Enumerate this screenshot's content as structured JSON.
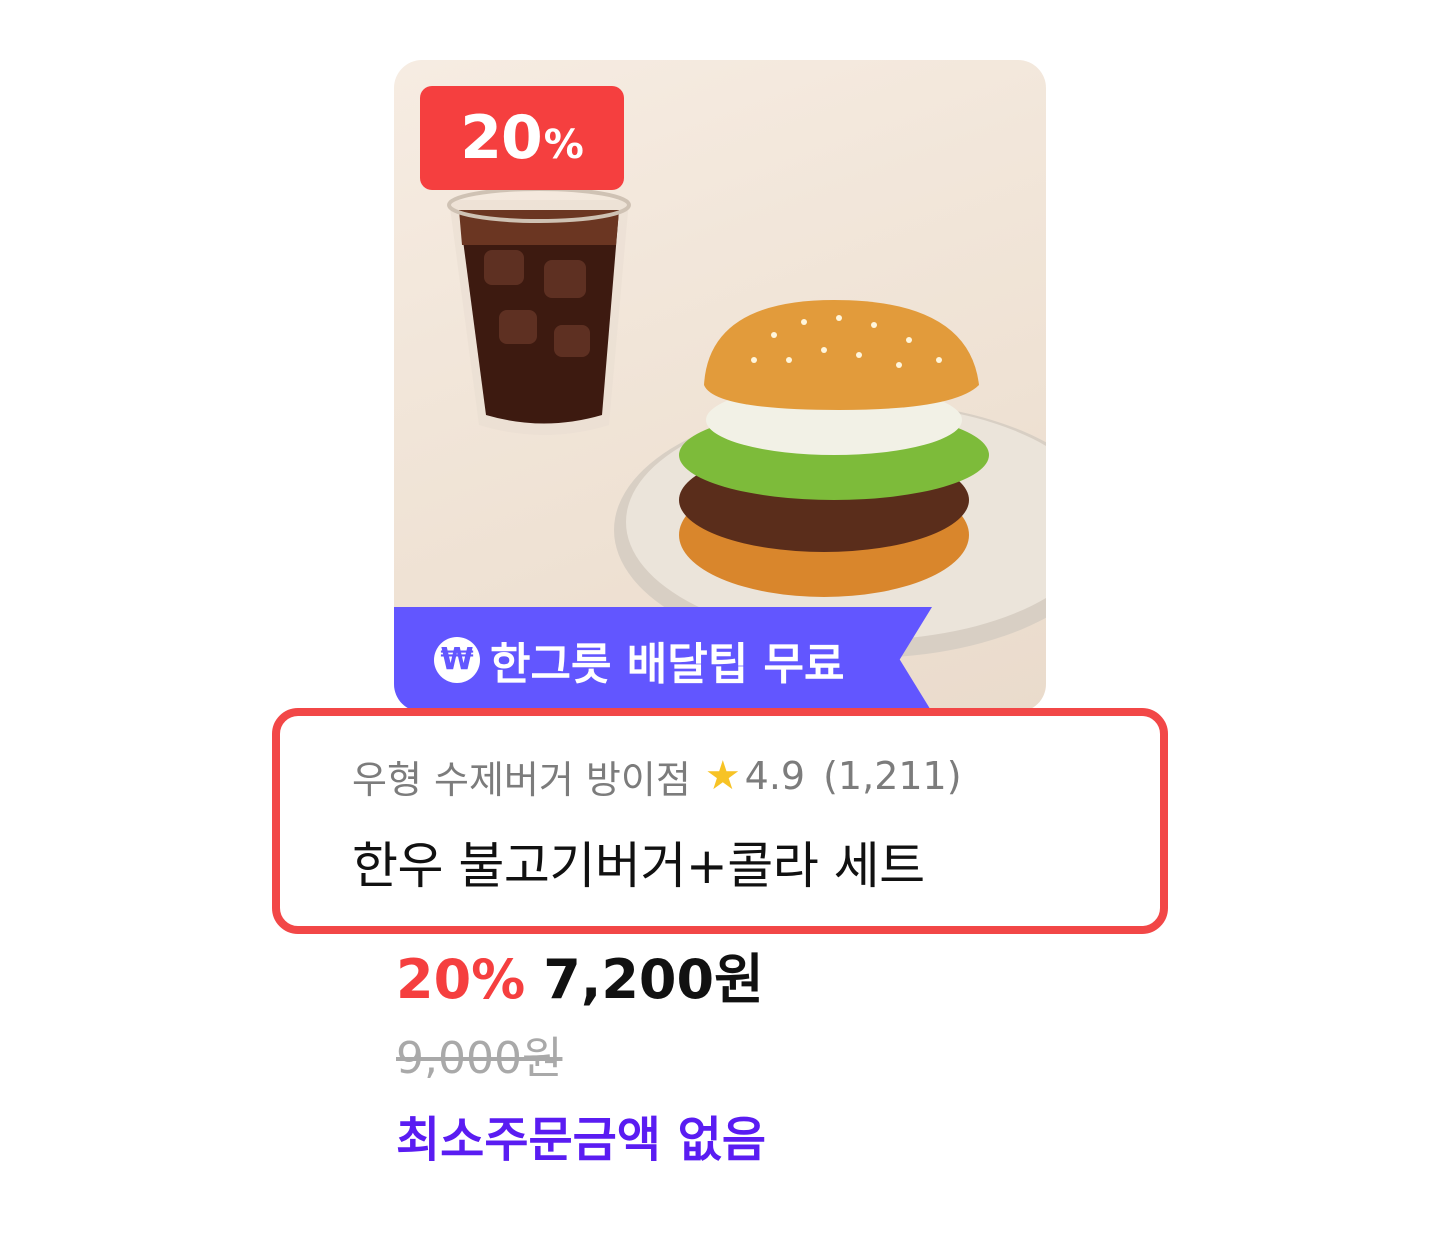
{
  "card": {
    "image_alt_icon": "burger-cola-photo",
    "discount_badge": {
      "value": "20",
      "suffix": "%"
    },
    "delivery_ribbon": {
      "icon": "won-coin-icon",
      "icon_glyph": "₩",
      "label": "한그릇 배달팁 무료"
    },
    "store": {
      "name": "우형 수제버거 방이점",
      "star_glyph": "★",
      "rating": "4.9",
      "review_count": "(1,211)"
    },
    "product_name": "한우 불고기버거+콜라 세트",
    "price": {
      "discount_pct": "20%",
      "current": "7,200원",
      "original": "9,000원"
    },
    "min_order_text": "최소주문금액 없음"
  },
  "colors": {
    "discount_red": "#f53f3f",
    "ribbon_purple": "#6256ff",
    "highlight_border": "#f24747",
    "min_order_purple": "#5a1cf2",
    "star_yellow": "#f7c325"
  }
}
